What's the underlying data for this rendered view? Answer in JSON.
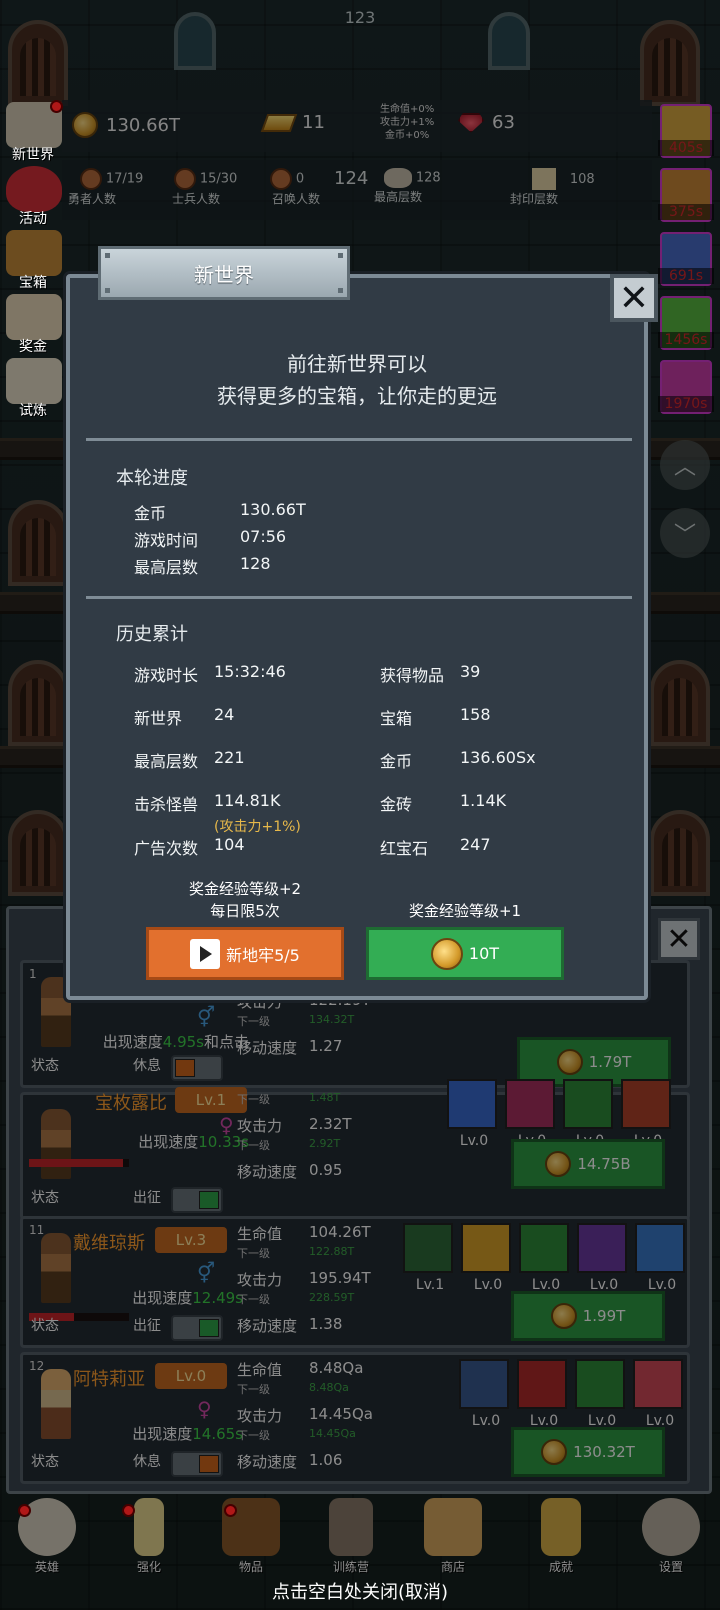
{
  "top_counter": "123",
  "resources": {
    "gold": "130.66T",
    "gold_bars": "11",
    "rubies": "63",
    "bonus_hp": "生命值+0%",
    "bonus_atk": "攻击力+1%",
    "bonus_gold": "金币+0%"
  },
  "stats_row": {
    "hero_count": "17/19",
    "hero_label": "勇者人数",
    "soldier_count": "15/30",
    "soldier_label": "士兵人数",
    "summon_count": "0",
    "summon_label": "召唤人数",
    "current_floor": "124",
    "max_floor": "128",
    "max_floor_label": "最高层数",
    "seal_floor": "108",
    "seal_floor_label": "封印层数"
  },
  "side_left": [
    {
      "label": "新世界"
    },
    {
      "label": "活动"
    },
    {
      "label": "宝箱"
    },
    {
      "label": "奖金"
    },
    {
      "label": "试炼"
    }
  ],
  "side_right": [
    {
      "timer": "405s"
    },
    {
      "timer": "375s"
    },
    {
      "timer": "691s"
    },
    {
      "timer": "1456s"
    },
    {
      "timer": "1970s"
    }
  ],
  "modal": {
    "title": "新世界",
    "desc_line1": "前往新世界可以",
    "desc_line2": "获得更多的宝箱，让你走的更远",
    "round_title": "本轮进度",
    "round": [
      {
        "label": "金币",
        "value": "130.66T"
      },
      {
        "label": "游戏时间",
        "value": "07:56"
      },
      {
        "label": "最高层数",
        "value": "128"
      }
    ],
    "history_title": "历史累计",
    "history_left": [
      {
        "label": "游戏时长",
        "value": "15:32:46"
      },
      {
        "label": "新世界",
        "value": "24"
      },
      {
        "label": "最高层数",
        "value": "221"
      },
      {
        "label": "击杀怪兽",
        "value": "114.81K"
      },
      {
        "label": "广告次数",
        "value": "104"
      }
    ],
    "kill_buff": "(攻击力+1%)",
    "history_right": [
      {
        "label": "获得物品",
        "value": "39"
      },
      {
        "label": "宝箱",
        "value": "158"
      },
      {
        "label": "金币",
        "value": "136.60Sx"
      },
      {
        "label": "金砖",
        "value": "1.14K"
      },
      {
        "label": "红宝石",
        "value": "247"
      }
    ],
    "ad_note1": "奖金经验等级+2",
    "ad_note2": "每日限5次",
    "gold_note": "奖金经验等级+1",
    "ad_button": "新地牢5/5",
    "gold_button": "10T"
  },
  "heroes": [
    {
      "num": "1",
      "name": "",
      "level": "",
      "speed_prefix": "出现速度",
      "speed": "4.95s",
      "speed_suffix": "和点击",
      "state": "休息",
      "hp": "",
      "hp_next": "",
      "atk": "122.19T",
      "atk_next": "134.32T",
      "move": "1.27",
      "cost": "1.79T"
    },
    {
      "num": "",
      "name": "宝枚露比",
      "level": "Lv.1",
      "speed_prefix": "出现速度",
      "speed": "10.33s",
      "speed_suffix": "",
      "state": "出征",
      "hp": "",
      "hp_next": "1.48T",
      "atk": "2.32T",
      "atk_next": "2.92T",
      "move": "0.95",
      "cost": "14.75B"
    },
    {
      "num": "11",
      "name": "戴维琼斯",
      "level": "Lv.3",
      "speed_prefix": "出现速度",
      "speed": "12.49s",
      "speed_suffix": "",
      "state": "出征",
      "hp": "104.26T",
      "hp_next": "122.88T",
      "atk": "195.94T",
      "atk_next": "228.59T",
      "move": "1.38",
      "cost": "1.99T"
    },
    {
      "num": "12",
      "name": "阿特莉亚",
      "level": "Lv.0",
      "speed_prefix": "出现速度",
      "speed": "14.65s",
      "speed_suffix": "",
      "state": "休息",
      "hp": "8.48Qa",
      "hp_next": "8.48Qa",
      "atk": "14.45Qa",
      "atk_next": "14.45Qa",
      "move": "1.06",
      "cost": "130.32T"
    }
  ],
  "hero_labels": {
    "status": "状态",
    "hp": "生命值",
    "atk": "攻击力",
    "next": "下一级",
    "move": "移动速度"
  },
  "skill_levels": {
    "row2": [
      "Lv.0",
      "Lv.0",
      "Lv.0",
      "Lv.0"
    ],
    "row3": [
      "Lv.1",
      "Lv.0",
      "Lv.0",
      "Lv.0",
      "Lv.0"
    ],
    "row4": [
      "Lv.0",
      "Lv.0",
      "Lv.0",
      "Lv.0"
    ]
  },
  "bottom_nav": [
    {
      "label": "英雄"
    },
    {
      "label": "强化"
    },
    {
      "label": "物品"
    },
    {
      "label": "训练营"
    },
    {
      "label": "商店"
    },
    {
      "label": "成就"
    },
    {
      "label": "设置"
    }
  ],
  "tap_close": "点击空白处关闭(取消)",
  "colors": {
    "accent_green": "#3fd24a",
    "orange": "#e2702e",
    "green_btn": "#33ad54",
    "timer_red": "#d8292c"
  }
}
